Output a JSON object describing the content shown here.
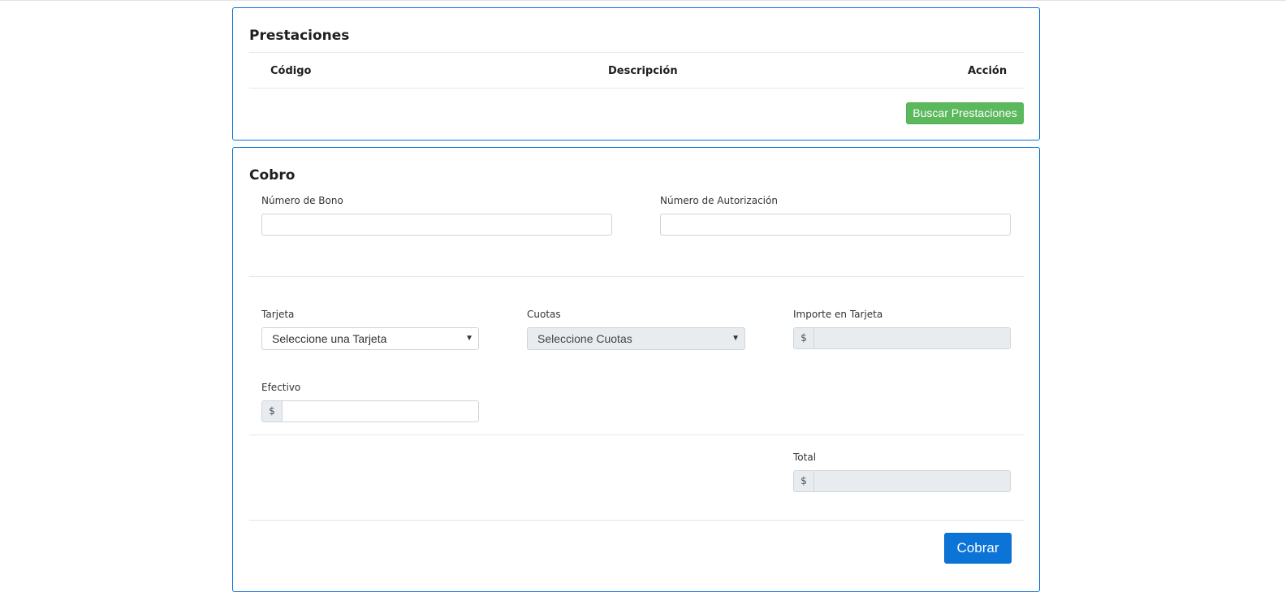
{
  "prestaciones": {
    "title": "Prestaciones",
    "columns": [
      "Código",
      "Descripción",
      "Acción"
    ],
    "buscar_button": "Buscar Prestaciones"
  },
  "cobro": {
    "title": "Cobro",
    "numero_bono": {
      "label": "Número de Bono",
      "value": ""
    },
    "numero_autorizacion": {
      "label": "Número de Autorización",
      "value": ""
    },
    "tarjeta": {
      "label": "Tarjeta",
      "selected": "Seleccione una Tarjeta"
    },
    "cuotas": {
      "label": "Cuotas",
      "selected": "Seleccione Cuotas"
    },
    "importe_tarjeta": {
      "label": "Importe en Tarjeta",
      "currency": "$",
      "value": ""
    },
    "efectivo": {
      "label": "Efectivo",
      "currency": "$",
      "value": ""
    },
    "total": {
      "label": "Total",
      "currency": "$",
      "value": ""
    },
    "cobrar_button": "Cobrar"
  },
  "colors": {
    "border_accent": "#0b74d6",
    "success": "#5cb85c",
    "primary": "#0b74d6"
  }
}
